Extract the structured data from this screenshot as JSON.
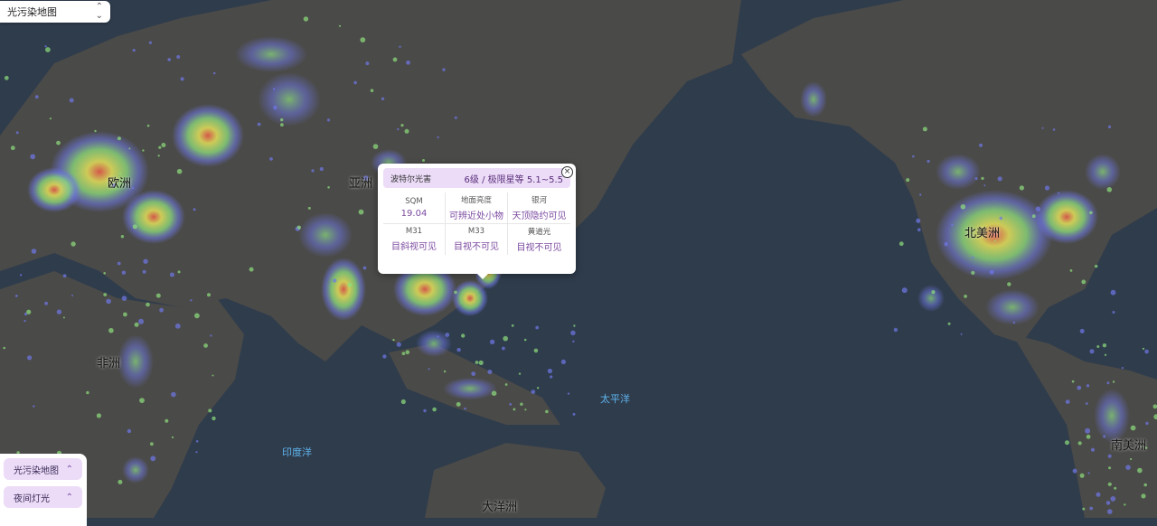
{
  "layer_select": {
    "value": "光污染地图",
    "chevron_icon": "chevron-updown-icon"
  },
  "labels": {
    "europe": "欧洲",
    "asia": "亚洲",
    "africa": "非洲",
    "north_america": "北美洲",
    "south_america": "南美洲",
    "oceania": "大洋洲",
    "pacific": "太平洋",
    "indian": "印度洋"
  },
  "popup": {
    "scale_name": "波特尔光害",
    "scale_value": "6级 / 极限星等 5.1~5.5",
    "close_icon": "close-icon",
    "metrics": [
      {
        "title": "SQM",
        "value": "19.04"
      },
      {
        "title": "地面亮度",
        "value": "可辨近处小物"
      },
      {
        "title": "银河",
        "value": "天顶隐约可见"
      },
      {
        "title": "M31",
        "value": "目斜视可见"
      },
      {
        "title": "M33",
        "value": "目视不可见"
      },
      {
        "title": "黄道光",
        "value": "目视不可见"
      }
    ]
  },
  "panel": {
    "buttons": [
      {
        "label": "光污染地图",
        "icon": "chevron-up-icon"
      },
      {
        "label": "夜间灯光",
        "icon": "chevron-up-icon"
      }
    ]
  },
  "colors": {
    "ocean": "#2f3c4c",
    "land": "#4a4a48",
    "glow_purple": "#6f78e8",
    "glow_green": "#8ee07e",
    "glow_yellow": "#e5e15a",
    "glow_red": "#e25a4a",
    "popup_header": "#ecdcf8",
    "accent": "#7b4aa0"
  }
}
